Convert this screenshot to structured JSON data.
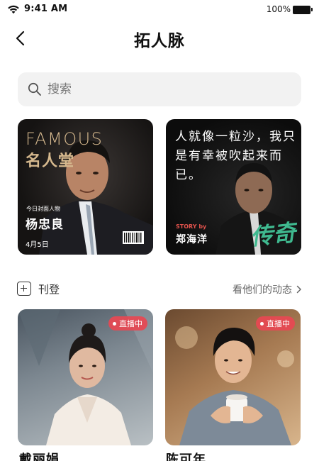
{
  "status_bar": {
    "time": "9:41 AM",
    "battery_percent": "100%",
    "icons": [
      "wifi-icon",
      "battery-icon"
    ]
  },
  "header": {
    "title": "拓人脉",
    "back_icon": "chevron-left-icon"
  },
  "search": {
    "placeholder": "搜索",
    "value": "",
    "icon": "search-icon"
  },
  "featured": [
    {
      "title": "FAMOUS",
      "subtitle": "名人堂",
      "tag": "今日封面人物",
      "name": "杨忠良",
      "date": "4月5日"
    },
    {
      "quote": "人就像一粒沙，我只是有幸被吹起来而已。",
      "story_label": "STORY by",
      "name": "郑海洋",
      "brand_text": "传奇",
      "brand_color": "#3fb98f"
    }
  ],
  "section": {
    "post_label": "刊登",
    "post_icon": "plus-box-icon",
    "activity_link": "看他们的动态",
    "activity_icon": "chevron-right-icon"
  },
  "live_cards": [
    {
      "badge": "直播中",
      "name": "戴丽娟"
    },
    {
      "badge": "直播中",
      "name": "陈可年"
    }
  ],
  "colors": {
    "accent_gold": "#d6b98e",
    "live_red": "#e84852",
    "search_bg": "#f2f2f2"
  }
}
